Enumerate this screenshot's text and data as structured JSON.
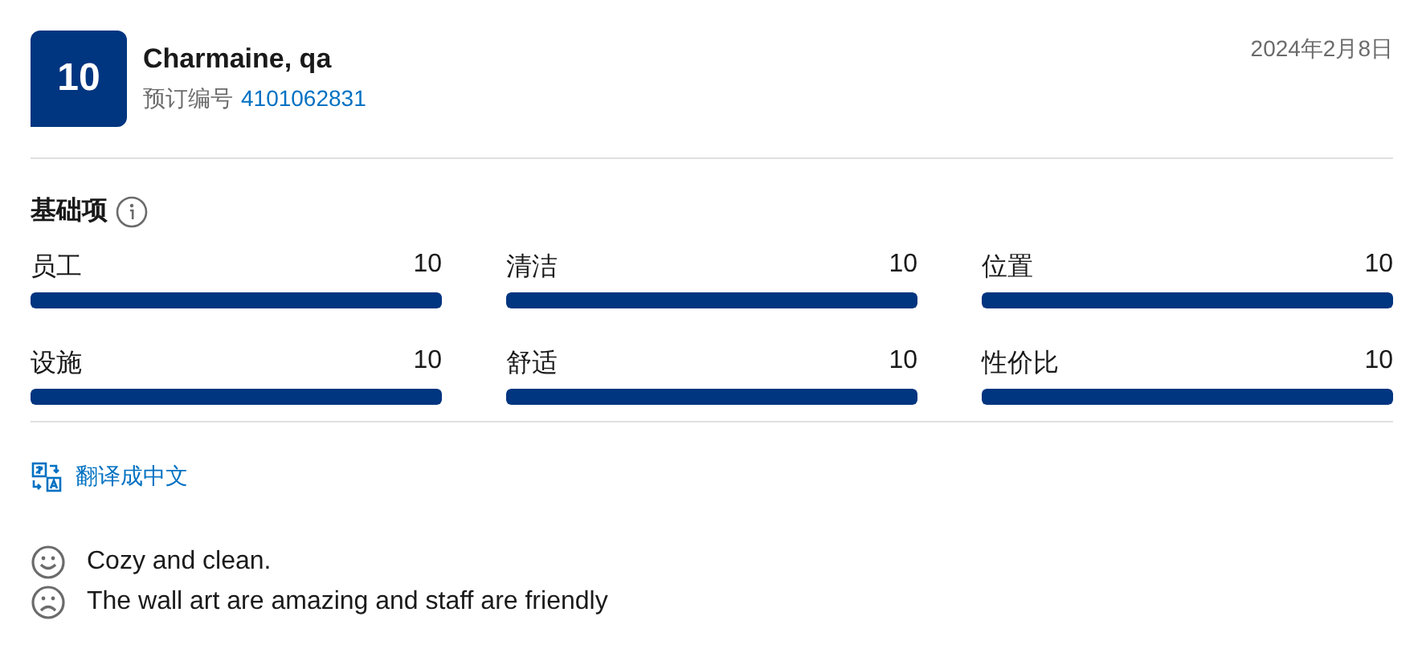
{
  "header": {
    "score": "10",
    "name": "Charmaine, qa",
    "booking_label": "预订编号",
    "booking_number": "4101062831",
    "date": "2024年2月8日"
  },
  "section_title": "基础项",
  "ratings": [
    {
      "label": "员工",
      "value": "10",
      "level": 1
    },
    {
      "label": "清洁",
      "value": "10",
      "level": 1
    },
    {
      "label": "位置",
      "value": "10",
      "level": 1
    },
    {
      "label": "设施",
      "value": "10",
      "level": 1
    },
    {
      "label": "舒适",
      "value": "10",
      "level": 1
    },
    {
      "label": "性价比",
      "value": "10",
      "level": 1
    }
  ],
  "translate_link": "翻译成中文",
  "reviews": [
    {
      "kind": "positive",
      "text": "Cozy and clean."
    },
    {
      "kind": "negative",
      "text": "The wall art are amazing and staff are friendly"
    }
  ]
}
